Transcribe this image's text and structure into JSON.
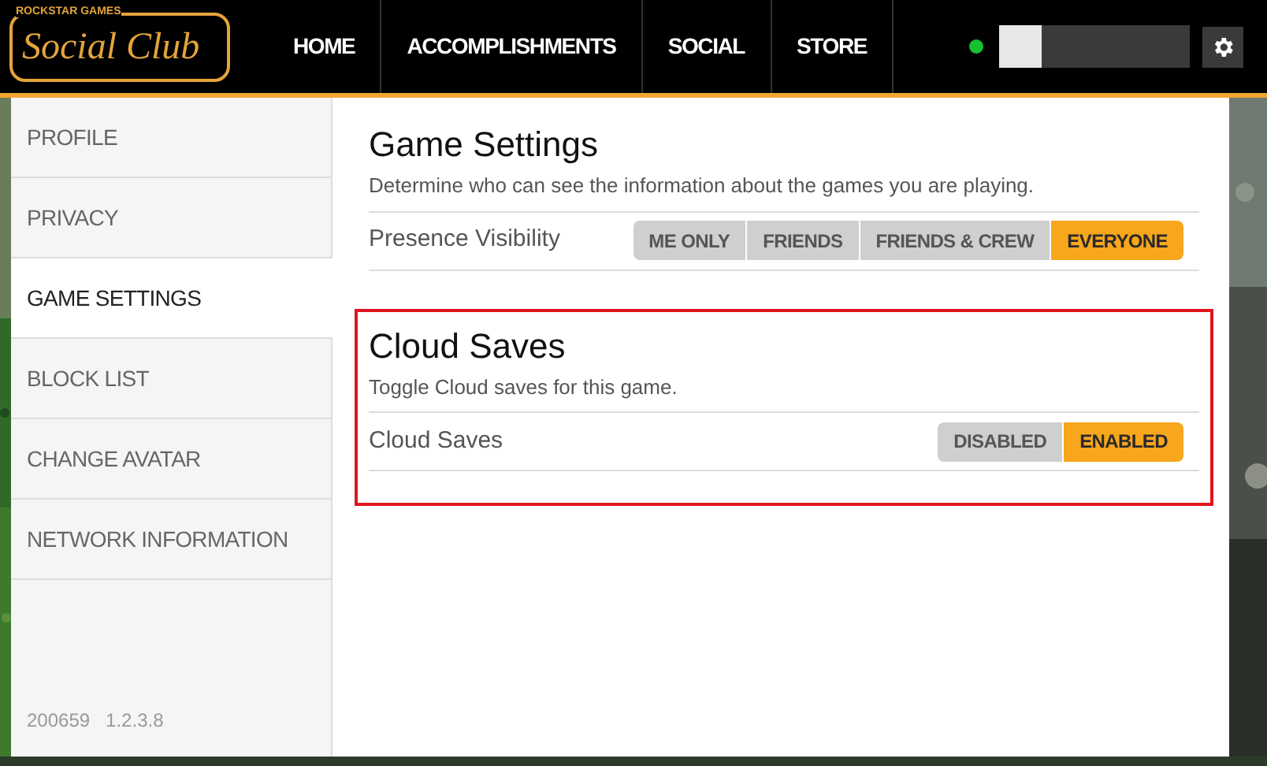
{
  "logo": {
    "brand": "ROCKSTAR GAMES",
    "name": "Social Club"
  },
  "nav": [
    {
      "label": "HOME"
    },
    {
      "label": "ACCOMPLISHMENTS"
    },
    {
      "label": "SOCIAL"
    },
    {
      "label": "STORE"
    }
  ],
  "user": {
    "online": true
  },
  "sidebar": {
    "items": [
      {
        "label": "PROFILE",
        "selected": false
      },
      {
        "label": "PRIVACY",
        "selected": false
      },
      {
        "label": "GAME SETTINGS",
        "selected": true
      },
      {
        "label": "BLOCK LIST",
        "selected": false
      },
      {
        "label": "CHANGE AVATAR",
        "selected": false
      },
      {
        "label": "NETWORK INFORMATION",
        "selected": false
      }
    ],
    "footer": [
      "200659",
      "1.2.3.8"
    ]
  },
  "sections": [
    {
      "title": "Game Settings",
      "description": "Determine who can see the information about the games you are playing.",
      "highlighted": false,
      "setting": {
        "label": "Presence Visibility",
        "options": [
          {
            "label": "ME ONLY",
            "selected": false
          },
          {
            "label": "FRIENDS",
            "selected": false
          },
          {
            "label": "FRIENDS & CREW",
            "selected": false
          },
          {
            "label": "EVERYONE",
            "selected": true
          }
        ]
      }
    },
    {
      "title": "Cloud Saves",
      "description": "Toggle Cloud saves for this game.",
      "highlighted": true,
      "setting": {
        "label": "Cloud Saves",
        "options": [
          {
            "label": "DISABLED",
            "selected": false
          },
          {
            "label": "ENABLED",
            "selected": true
          }
        ]
      }
    }
  ]
}
